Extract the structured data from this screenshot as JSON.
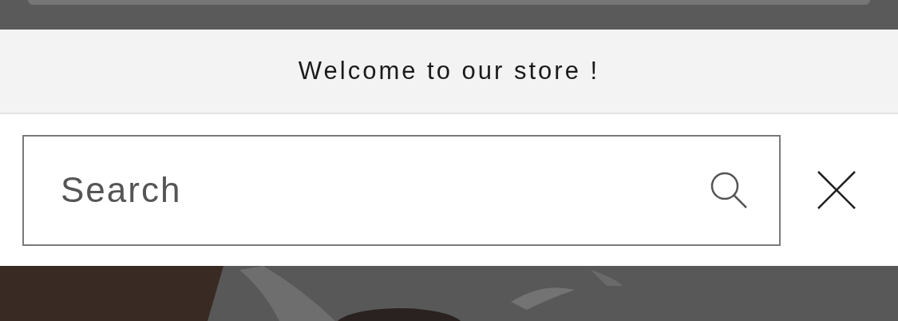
{
  "announcement": {
    "text": "Welcome to our store !"
  },
  "search": {
    "placeholder": "Search"
  }
}
